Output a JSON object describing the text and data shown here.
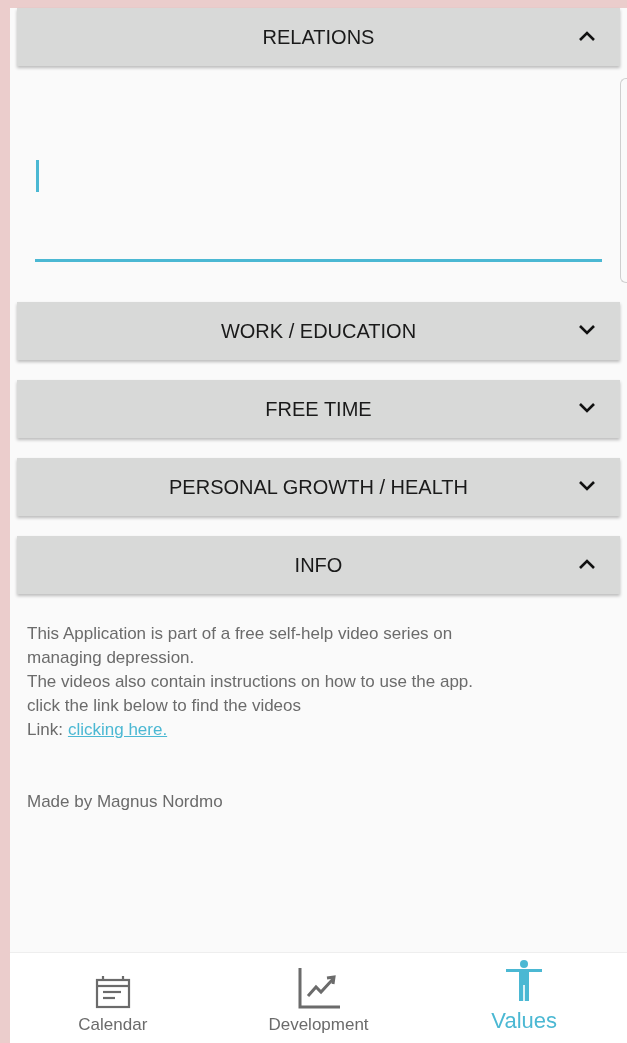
{
  "sections": [
    {
      "title": "RELATIONS",
      "expanded": true,
      "kind": "field",
      "field": {
        "focused": true
      }
    },
    {
      "title": "WORK / EDUCATION",
      "expanded": false
    },
    {
      "title": "FREE TIME",
      "expanded": false
    },
    {
      "title": "PERSONAL GROWTH / HEALTH",
      "expanded": false
    },
    {
      "title": "INFO",
      "expanded": true,
      "kind": "info",
      "info": {
        "lines": [
          "This Application is part of a free self-help video series on managing depression.",
          "The videos also contain instructions on how to use the app.",
          "click the link below to find the videos"
        ],
        "link_label": "Link:",
        "link": "clicking here.",
        "credit": "Made by Magnus Nordmo"
      }
    }
  ],
  "nav": [
    {
      "label": "Calendar",
      "kind": "calendar",
      "selected": false
    },
    {
      "label": "Development",
      "kind": "chart",
      "selected": false
    },
    {
      "label": "Values",
      "kind": "person",
      "selected": true
    }
  ]
}
